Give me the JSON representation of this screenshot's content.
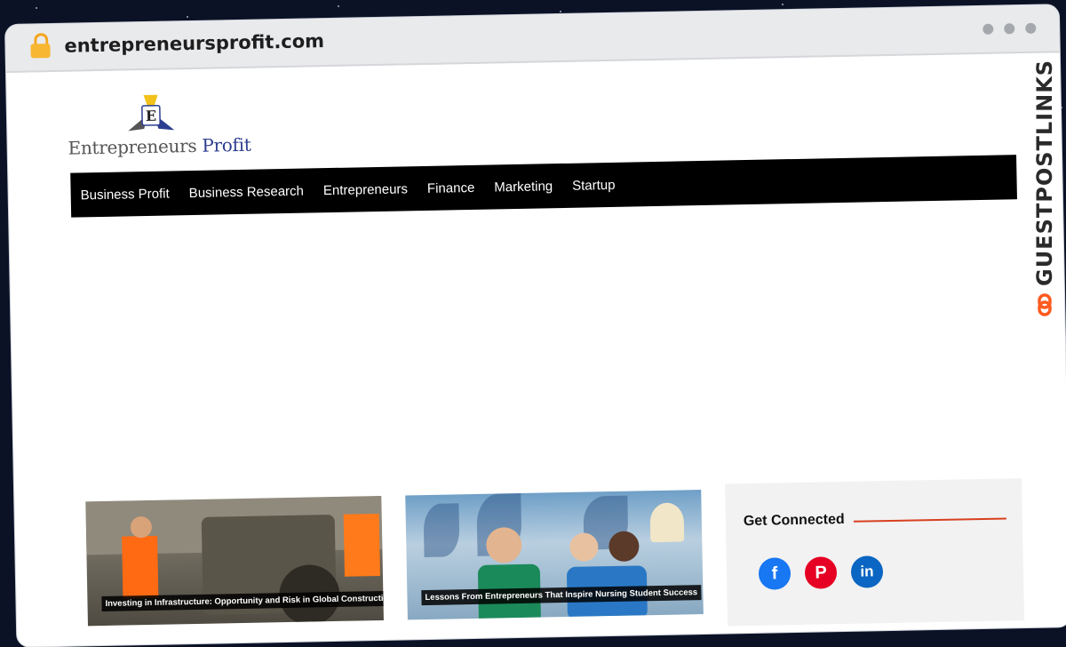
{
  "browser": {
    "url": "entrepreneursprofit.com"
  },
  "site": {
    "logo_text_main": "Entrepreneurs",
    "logo_text_accent": "Profit",
    "logo_letter": "E"
  },
  "nav": {
    "items": [
      {
        "label": "Business Profit"
      },
      {
        "label": "Business Research"
      },
      {
        "label": "Entrepreneurs"
      },
      {
        "label": "Finance"
      },
      {
        "label": "Marketing"
      },
      {
        "label": "Startup"
      }
    ]
  },
  "articles": [
    {
      "caption": "Investing in Infrastructure: Opportunity and Risk in Global Construction"
    },
    {
      "caption": "Lessons From Entrepreneurs That Inspire Nursing Student Success"
    }
  ],
  "sidebar": {
    "title": "Get Connected",
    "socials": [
      {
        "icon": "facebook-icon",
        "glyph": "f",
        "color": "#1877f2"
      },
      {
        "icon": "pinterest-icon",
        "glyph": "P",
        "color": "#e60023"
      },
      {
        "icon": "linkedin-icon",
        "glyph": "in",
        "color": "#0a66c2"
      }
    ]
  },
  "watermark": {
    "text": "GUESTPOSTLINKS",
    "accent": "#ff5a1f"
  }
}
